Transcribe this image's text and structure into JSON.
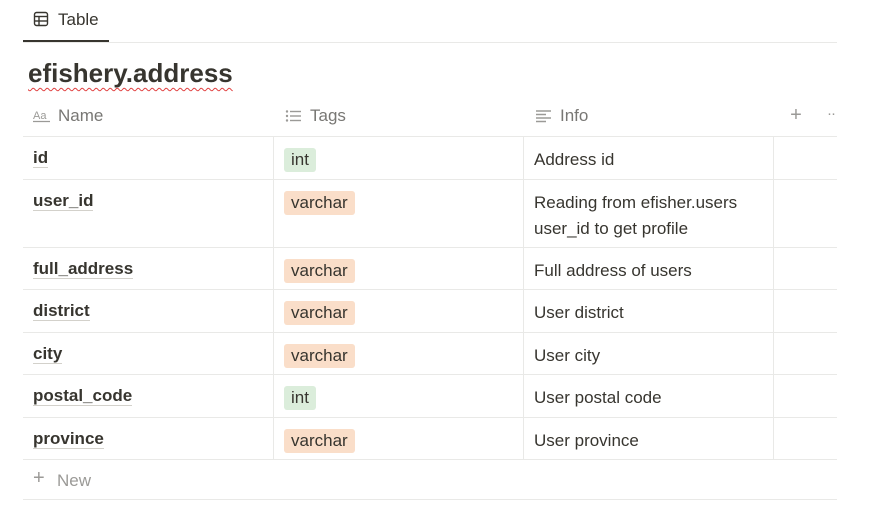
{
  "view_tab": {
    "label": "Table",
    "icon": "table-icon"
  },
  "title": "efishery.address",
  "columns": [
    {
      "label": "Name",
      "icon": "text-aa-icon"
    },
    {
      "label": "Tags",
      "icon": "list-icon"
    },
    {
      "label": "Info",
      "icon": "text-lines-icon"
    }
  ],
  "header_actions": {
    "add": "+",
    "more": "··"
  },
  "colors": {
    "tag_int": "#dbeddb",
    "tag_varchar": "#fadec9",
    "text": "#37352f",
    "muted": "#787774"
  },
  "rows": [
    {
      "name": "id",
      "tag": "int",
      "info": "Address id"
    },
    {
      "name": "user_id",
      "tag": "varchar",
      "info": "Reading from efisher.users user_id to get profile"
    },
    {
      "name": "full_address",
      "tag": "varchar",
      "info": "Full address of users"
    },
    {
      "name": "district",
      "tag": "varchar",
      "info": "User district"
    },
    {
      "name": "city",
      "tag": "varchar",
      "info": "User city"
    },
    {
      "name": "postal_code",
      "tag": "int",
      "info": "User postal code"
    },
    {
      "name": "province",
      "tag": "varchar",
      "info": "User province"
    }
  ],
  "new_row": {
    "plus": "+",
    "label": "New"
  }
}
